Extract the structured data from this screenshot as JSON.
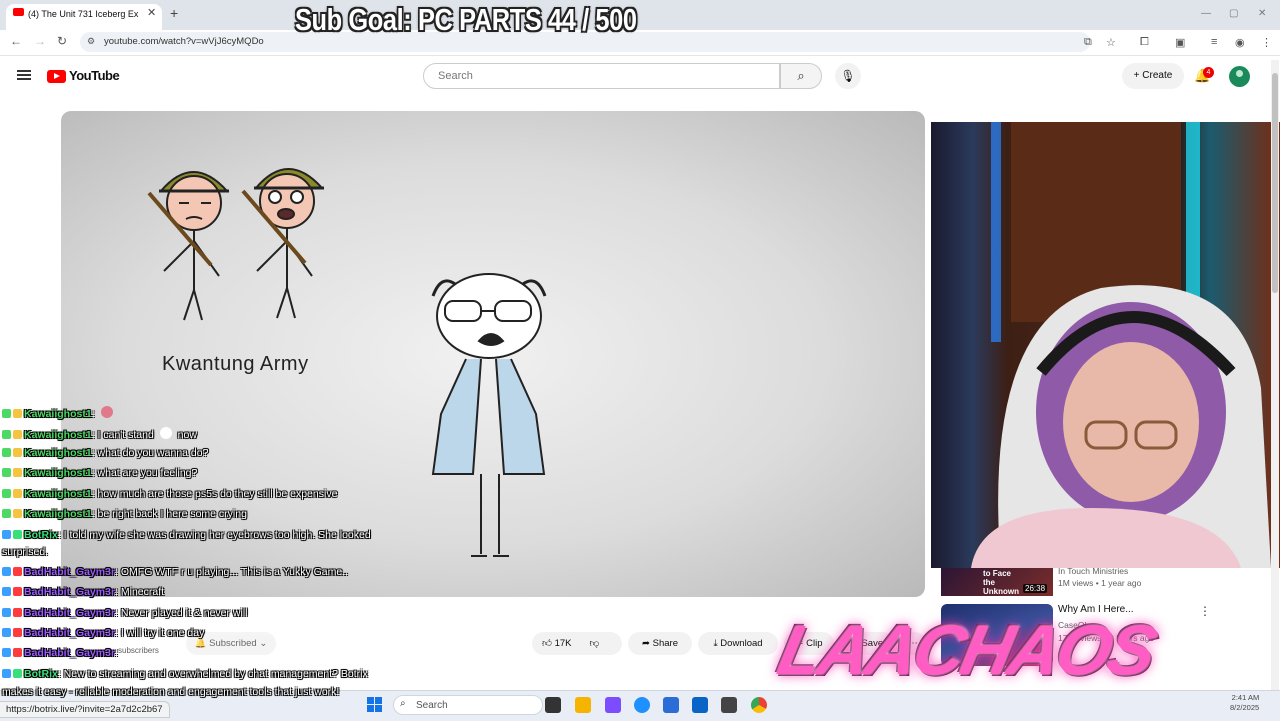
{
  "stream_overlay": {
    "sub_goal": "Sub Goal: PC PARTS  44 / 500",
    "status_url": "https://botrix.live/?invite=2a7d2c2b67",
    "brand_text": "LAACHAOS"
  },
  "browser": {
    "tab_title": "(4) The Unit 731 Iceberg Ex",
    "url": "youtube.com/watch?v=wVjJ6cyMQDo"
  },
  "youtube": {
    "brand": "YouTube",
    "search_placeholder": "Search",
    "create_label": "Create",
    "notification_count": "4",
    "video_caption": "Kwantung Army",
    "subscribed_label": "Subscribed",
    "subscriber_count": "subscribers",
    "like_count": "17K",
    "share_label": "Share",
    "download_label": "Download",
    "clip_label": "Clip",
    "save_label": "Save"
  },
  "recommended": [
    {
      "title": "",
      "channel": "In Touch Ministries",
      "meta": "1M views • 1 year ago",
      "duration": "26:38",
      "thumb_text": "to Face the Unknown"
    },
    {
      "title": "Why Am I Here...",
      "channel": "CaseOh",
      "meta": "177K views • 9 hours ago"
    }
  ],
  "chat": [
    {
      "user": "Kawaiighost1",
      "text": ": ",
      "color": "#4cd964",
      "emote": true
    },
    {
      "user": "Kawaiighost1",
      "text": ": I can't stand ",
      "text2": " now",
      "color": "#4cd964",
      "inline_emote": true
    },
    {
      "user": "Kawaiighost1",
      "text": ": what do you wanna do?",
      "color": "#4cd964"
    },
    {
      "user": "Kawaiighost1",
      "text": ": what are you feeling?",
      "color": "#4cd964"
    },
    {
      "user": "Kawaiighost1",
      "text": ": how much are those ps5s do they still be expensive",
      "color": "#4cd964"
    },
    {
      "user": "Kawaiighost1",
      "text": ": be right back I here some crying",
      "color": "#4cd964"
    },
    {
      "user": "BotRix",
      "text": ": I told my wife she was drawing her eyebrows too high. She looked",
      "cont": "surprised.",
      "color": "#39e07a"
    },
    {
      "user": "BadHabit_Gaym3r",
      "text": ": OMFG WTF r u playing... This is a Yukky Game..",
      "color": "#9b59ff"
    },
    {
      "user": "BadHabit_Gaym3r",
      "text": ": Minecraft",
      "color": "#9b59ff"
    },
    {
      "user": "BadHabit_Gaym3r",
      "text": ": Never played it & never will",
      "color": "#9b59ff"
    },
    {
      "user": "BadHabit_Gaym3r",
      "text": ": I will try it one day",
      "color": "#9b59ff"
    },
    {
      "user": "BadHabit_Gaym3r",
      "text": ": ",
      "color": "#9b59ff"
    },
    {
      "user": "BotRix",
      "text": ": New to streaming and overwhelmed by chat management? Botrix",
      "cont": "makes it easy - reliable moderation and engagement tools that just work!",
      "color": "#39e07a"
    }
  ],
  "taskbar": {
    "search_placeholder": "Search",
    "time": "2:41 AM",
    "date": "8/2/2025"
  }
}
